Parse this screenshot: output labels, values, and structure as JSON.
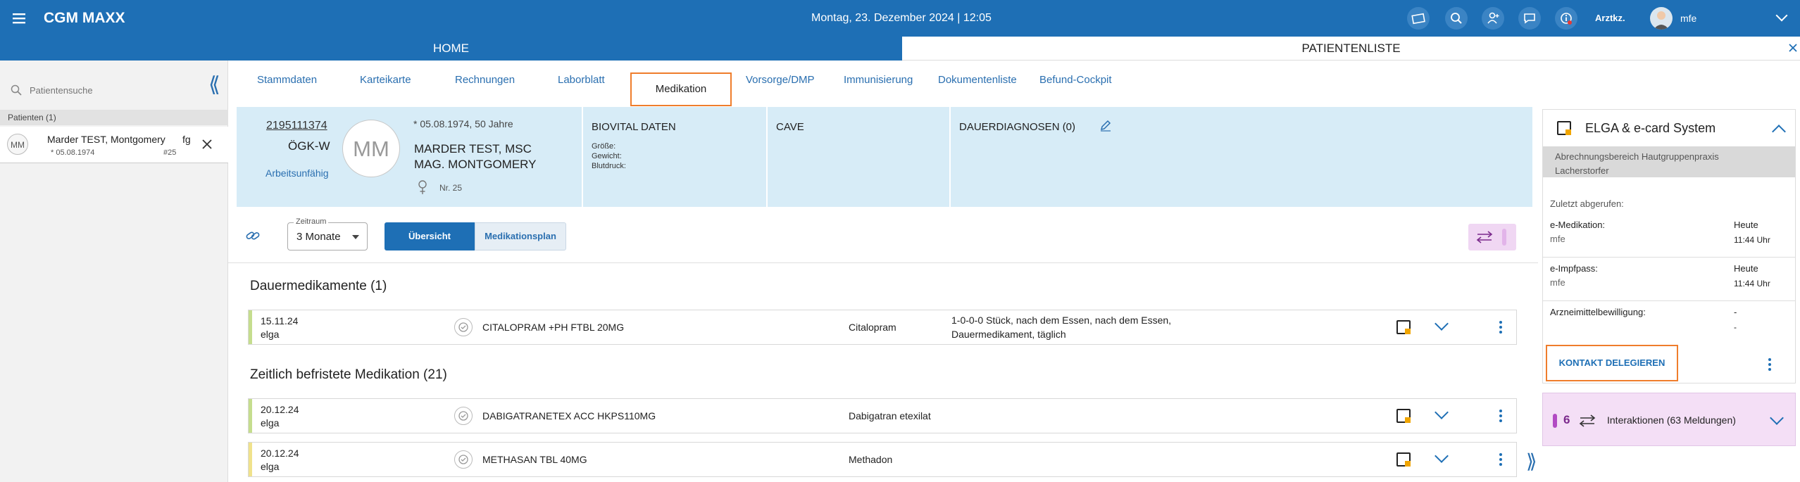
{
  "topbar": {
    "app_title": "CGM MAXX",
    "datetime": "Montag, 23. Dezember 2024 | 12:05",
    "role": "Arztkz.",
    "user": "mfe"
  },
  "nav": {
    "home": "HOME",
    "patient_list": "PATIENTENLISTE"
  },
  "left": {
    "search_placeholder": "Patientensuche",
    "patients_header": "Patienten (1)",
    "patient": {
      "initials": "MM",
      "name": "Marder TEST, Montgomery",
      "code": "fg",
      "dob": "* 05.08.1974",
      "number": "#25"
    }
  },
  "tabs": [
    "Stammdaten",
    "Karteikarte",
    "Rechnungen",
    "Laborblatt",
    "Medikation",
    "Vorsorge/DMP",
    "Immunisierung",
    "Dokumentenliste",
    "Befund-Cockpit"
  ],
  "patient_header": {
    "svnr": "2195111374",
    "insurance": "ÖGK-W",
    "status_link": "Arbeitsunfähig",
    "initials": "MM",
    "dob_age": "* 05.08.1974, 50 Jahre",
    "name_line1": "MARDER TEST, MSC",
    "name_line2": "MAG. MONTGOMERY",
    "nr": "Nr. 25",
    "biovital_title": "BIOVITAL DATEN",
    "groesse": "Größe:",
    "gewicht": "Gewicht:",
    "blutdruck": "Blutdruck:",
    "cave": "CAVE",
    "dauerdiagnosen": "DAUERDIAGNOSEN (0)"
  },
  "toolbar": {
    "zeitraum_label": "Zeitraum",
    "zeitraum_value": "3 Monate",
    "btn_uebersicht": "Übersicht",
    "btn_medplan": "Medikationsplan"
  },
  "dauer": {
    "title": "Dauermedikamente (1)",
    "rows": [
      {
        "date": "15.11.24",
        "source": "elga",
        "name": "CITALOPRAM +PH FTBL 20MG",
        "substance": "Citalopram",
        "dosage1": "1-0-0-0 Stück, nach dem Essen, nach dem Essen,",
        "dosage2": "Dauermedikament, täglich",
        "color": "#c5dd8e"
      }
    ]
  },
  "zeitlich": {
    "title": "Zeitlich befristete Medikation (21)",
    "rows": [
      {
        "date": "20.12.24",
        "source": "elga",
        "name": "DABIGATRANETEX ACC HKPS110MG",
        "substance": "Dabigatran etexilat",
        "color": "#c5dd8e"
      },
      {
        "date": "20.12.24",
        "source": "elga",
        "name": "METHASAN TBL 40MG",
        "substance": "Methadon",
        "color": "#f0e28c"
      }
    ]
  },
  "elga": {
    "title": "ELGA & e-card System",
    "area": "Abrechnungsbereich Hautgruppenpraxis Lacherstorfer",
    "last_called": "Zuletzt abgerufen:",
    "items": [
      {
        "label": "e-Medikation:",
        "user": "mfe",
        "day": "Heute",
        "time": "11:44 Uhr"
      },
      {
        "label": "e-Impfpass:",
        "user": "mfe",
        "day": "Heute",
        "time": "11:44 Uhr"
      },
      {
        "label": "Arzneimittelbewilligung:",
        "user": "",
        "day": "-",
        "time": "-"
      }
    ],
    "delegate_btn": "KONTAKT DELEGIEREN"
  },
  "interactions": {
    "count": "6",
    "label": "Interaktionen (63 Meldungen)"
  }
}
